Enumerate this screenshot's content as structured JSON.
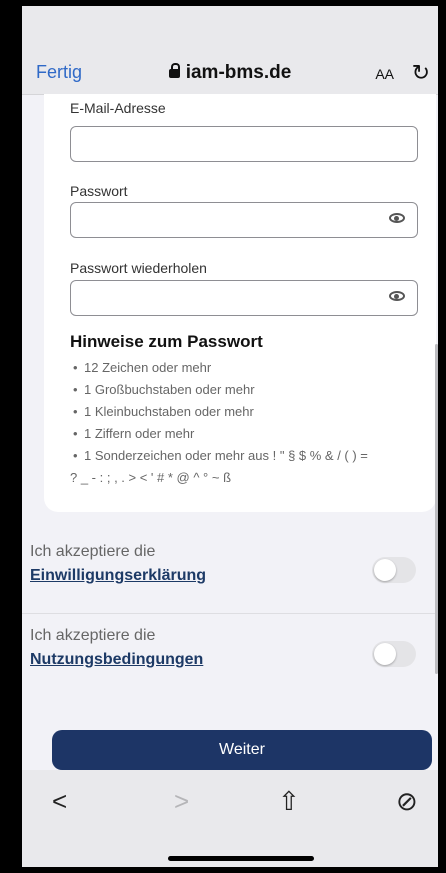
{
  "browser": {
    "done_label": "Fertig",
    "url": "iam-bms.de",
    "text_size_label": "AA",
    "reload_glyph": "↻"
  },
  "form": {
    "email_label": "E-Mail-Adresse",
    "email_value": "",
    "password_label": "Passwort",
    "password_value": "",
    "password_repeat_label": "Passwort wiederholen",
    "password_repeat_value": ""
  },
  "hints": {
    "title": "Hinweise zum Passwort",
    "items": [
      "12 Zeichen oder mehr",
      "1 Großbuchstaben oder mehr",
      "1 Kleinbuchstaben oder mehr",
      "1 Ziffern oder mehr",
      "1 Sonderzeichen oder mehr aus ! \" § $ % & / ( ) =",
      "? _ - : ; , . > < ' # * @ ^ ° ~ ß"
    ]
  },
  "consents": [
    {
      "text": "Ich akzeptiere die",
      "link": "Einwilligungserklärung",
      "checked": false
    },
    {
      "text": "Ich akzeptiere die",
      "link": "Nutzungsbedingungen",
      "checked": false
    }
  ],
  "submit_label": "Weiter",
  "toolbar": {
    "back_glyph": "<",
    "forward_glyph": ">",
    "share_glyph": "⇧",
    "compass_glyph": "⊘"
  }
}
